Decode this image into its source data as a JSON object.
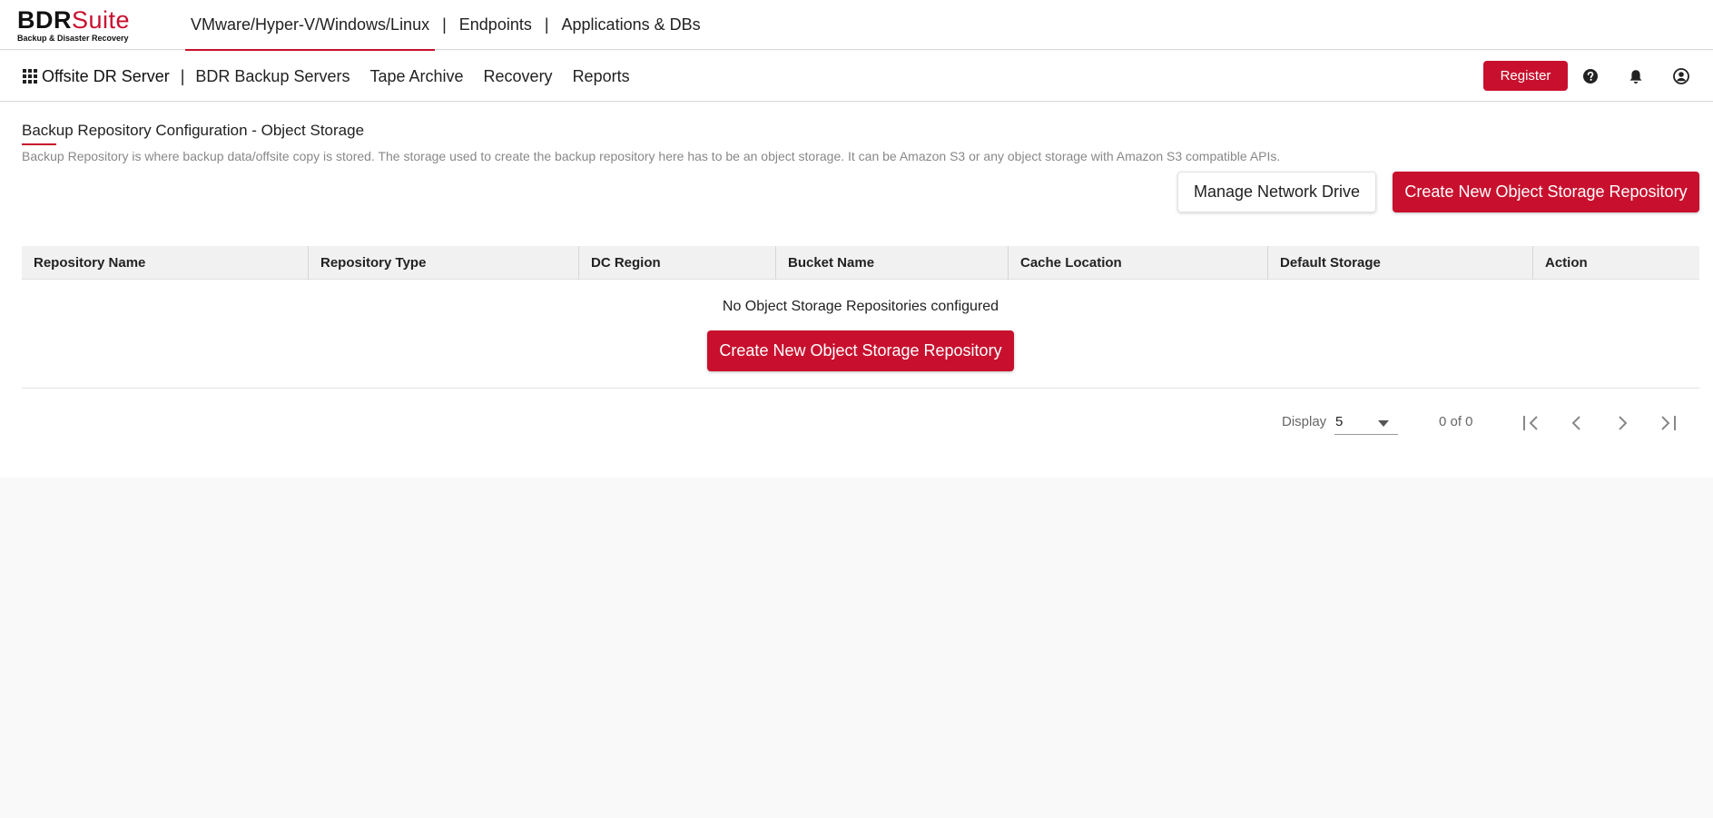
{
  "header": {
    "logo_main": "BDR",
    "logo_accent": "Suite",
    "logo_sub": "Backup & Disaster Recovery",
    "tabs": [
      {
        "label": "VMware/Hyper-V/Windows/Linux",
        "active": true
      },
      {
        "label": "Endpoints",
        "active": false
      },
      {
        "label": "Applications & DBs",
        "active": false
      }
    ],
    "separator": "|"
  },
  "subnav": {
    "brand": "Offsite DR Server",
    "separator": "|",
    "links": [
      "BDR Backup Servers",
      "Tape Archive",
      "Recovery",
      "Reports"
    ],
    "register_label": "Register",
    "icons": [
      "help-icon",
      "bell-icon",
      "user-account-icon"
    ]
  },
  "page": {
    "title": "Backup Repository Configuration - Object Storage",
    "description": "Backup Repository is where backup data/offsite copy is stored. The storage used to create the backup repository here has to be an object storage. It can be Amazon S3 or any object storage with Amazon S3 compatible APIs.",
    "manage_network_drive_label": "Manage Network Drive",
    "create_repo_label": "Create New Object Storage Repository"
  },
  "table": {
    "columns": [
      "Repository Name",
      "Repository Type",
      "DC Region",
      "Bucket Name",
      "Cache Location",
      "Default Storage",
      "Action"
    ],
    "empty_message": "No Object Storage Repositories configured",
    "empty_create_label": "Create New Object Storage Repository"
  },
  "pagination": {
    "display_label": "Display",
    "page_size": "5",
    "count_text": "0 of 0"
  },
  "colors": {
    "accent": "#c8102e",
    "background": "#f9f9f9",
    "header_bg": "#f1f1f1"
  }
}
